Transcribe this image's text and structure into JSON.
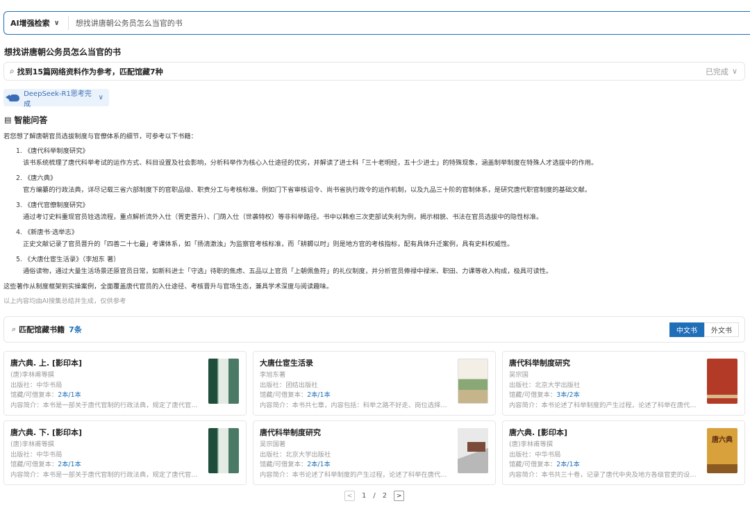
{
  "search": {
    "mode": "AI增强检索",
    "query": "想找讲唐朝公务员怎么当官的书"
  },
  "question": "想找讲唐朝公务员怎么当官的书",
  "found": {
    "text": "找到15篇网络资料作为参考，匹配馆藏7种",
    "status": "已完成"
  },
  "model": {
    "label": "DeepSeek-R1思考完成"
  },
  "qa": {
    "title": "智能问答",
    "intro": "若您想了解唐朝官员选拔制度与官僚体系的细节，可参考以下书籍：",
    "items": [
      {
        "title": "1. 《唐代科举制度研究》",
        "desc": "该书系统梳理了唐代科举考试的运作方式、科目设置及社会影响，分析科举作为核心入仕途径的优劣，并解读了进士科「三十老明经，五十少进士」的特殊现象，涵盖制举制度在特殊人才选拔中的作用。"
      },
      {
        "title": "2. 《唐六典》",
        "desc": "官方编纂的行政法典，详尽记载三省六部制度下的官职品级、职责分工与考核标准。例如门下省审核诏令、尚书省执行政令的运作机制，以及九品三十阶的官制体系，是研究唐代职官制度的基础文献。"
      },
      {
        "title": "3. 《唐代官僚制度研究》",
        "desc": "通过考订史料重现官员铨选流程，重点解析流外入仕（胥吏晋升）、门荫入仕（世袭特权）等非科举路径。书中以韩愈三次吏部试失利为例，揭示相貌、书法在官员选拔中的隐性标准。"
      },
      {
        "title": "4. 《新唐书·选举志》",
        "desc": "正史文献记录了官员晋升的「四善二十七最」考课体系，如「扬清激浊」为监察官考核标准，而「耕耨以时」则是地方官的考核指标，配有具体升迁案例，具有史料权威性。"
      },
      {
        "title": "5. 《大唐仕宦生活录》（李旭东 著）",
        "desc": "通俗读物，通过大量生活场景还原官员日常，如新科进士「守选」待职的焦虑、五品以上官员「上朝佩鱼符」的礼仪制度，并分析官员俸禄中禄米、职田、力课等收入构成，极具可读性。"
      }
    ],
    "outro": "这些著作从制度框架到实操案例，全面覆盖唐代官员的入仕途径、考核晋升与官场生态，兼具学术深度与阅读趣味。",
    "disclaimer": "以上内容均由AI搜集总结并生成，仅供参考"
  },
  "match": {
    "label": "匹配馆藏书籍",
    "count": "7条",
    "tab_cn": "中文书",
    "tab_foreign": "外文书"
  },
  "books": [
    {
      "title": "唐六典. 上. [影印本]",
      "author": "(唐)李林甫等撰",
      "publisher": "出版社：中华书局",
      "holdings_label": "馆藏/可借复本：",
      "holdings": "2本/1本",
      "summary": "内容简介：本书是一部关于唐代官制的行政法典，规定了唐代官制的设置和职掌",
      "cover": "cover-green",
      "cover_text": ""
    },
    {
      "title": "大唐仕宦生活录",
      "author": "李旭东著",
      "publisher": "出版社：团结出版社",
      "holdings_label": "馆藏/可借复本：",
      "holdings": "2本/1本",
      "summary": "内容简介：本书共七章，内容包括：科举之路不好走、岗位选择与仕宦生活等",
      "cover": "cover-paint",
      "cover_text": ""
    },
    {
      "title": "唐代科举制度研究",
      "author": "吴宗国",
      "publisher": "出版社：北京大学出版社",
      "holdings_label": "馆藏/可借复本：",
      "holdings": "3本/2本",
      "summary": "内容简介：本书论述了科举制度的产生过程，论述了科举在唐代的发展与影响",
      "cover": "cover-red",
      "cover_text": ""
    },
    {
      "title": "唐六典. 下. [影印本]",
      "author": "(唐)李林甫等撰",
      "publisher": "出版社：中华书局",
      "holdings_label": "馆藏/可借复本：",
      "holdings": "2本/1本",
      "summary": "内容简介：本书是一部关于唐代官制的行政法典，规定了唐代官制的设置和职掌",
      "cover": "cover-green",
      "cover_text": ""
    },
    {
      "title": "唐代科举制度研究",
      "author": "吴宗国著",
      "publisher": "出版社：北京大学出版社",
      "holdings_label": "馆藏/可借复本：",
      "holdings": "2本/1本",
      "summary": "内容简介：本书论述了科举制度的产生过程，论述了科举在唐代的发展与影响",
      "cover": "cover-gray",
      "cover_text": ""
    },
    {
      "title": "唐六典. [影印本]",
      "author": "(唐)李林甫等撰",
      "publisher": "出版社：中华书局",
      "holdings_label": "馆藏/可借复本：",
      "holdings": "2本/1本",
      "summary": "内容简介：本书共三十卷，记录了唐代中央及地方各级官吏的设置及职掌",
      "cover": "cover-yellow",
      "cover_text": "唐六典"
    }
  ],
  "pager": {
    "current": "1",
    "sep": "/",
    "total": "2"
  }
}
